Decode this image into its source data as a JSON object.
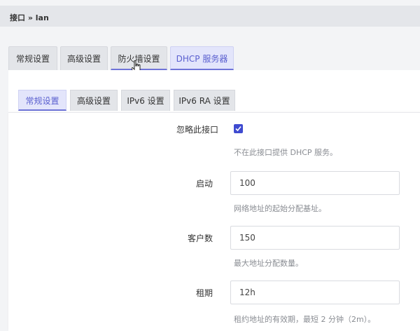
{
  "breadcrumb": "接口 » lan",
  "primary_tabs": [
    {
      "label": "常规设置"
    },
    {
      "label": "高级设置"
    },
    {
      "label": "防火墙设置"
    },
    {
      "label": "DHCP 服务器"
    }
  ],
  "sub_tabs": [
    {
      "label": "常规设置"
    },
    {
      "label": "高级设置"
    },
    {
      "label": "IPv6 设置"
    },
    {
      "label": "IPv6 RA 设置"
    }
  ],
  "form": {
    "ignore": {
      "label": "忽略此接口",
      "checked": true,
      "hint": "不在此接口提供 DHCP 服务。"
    },
    "start": {
      "label": "启动",
      "value": "100",
      "hint": "网络地址的起始分配基址。"
    },
    "limit": {
      "label": "客户数",
      "value": "150",
      "hint": "最大地址分配数量。"
    },
    "lease": {
      "label": "租期",
      "value": "12h",
      "hint": "租约地址的有效期，最短 2 分钟（2m）。"
    }
  },
  "colors": {
    "accent": "#5a5fcf",
    "checkbox": "#3f4bd0"
  }
}
